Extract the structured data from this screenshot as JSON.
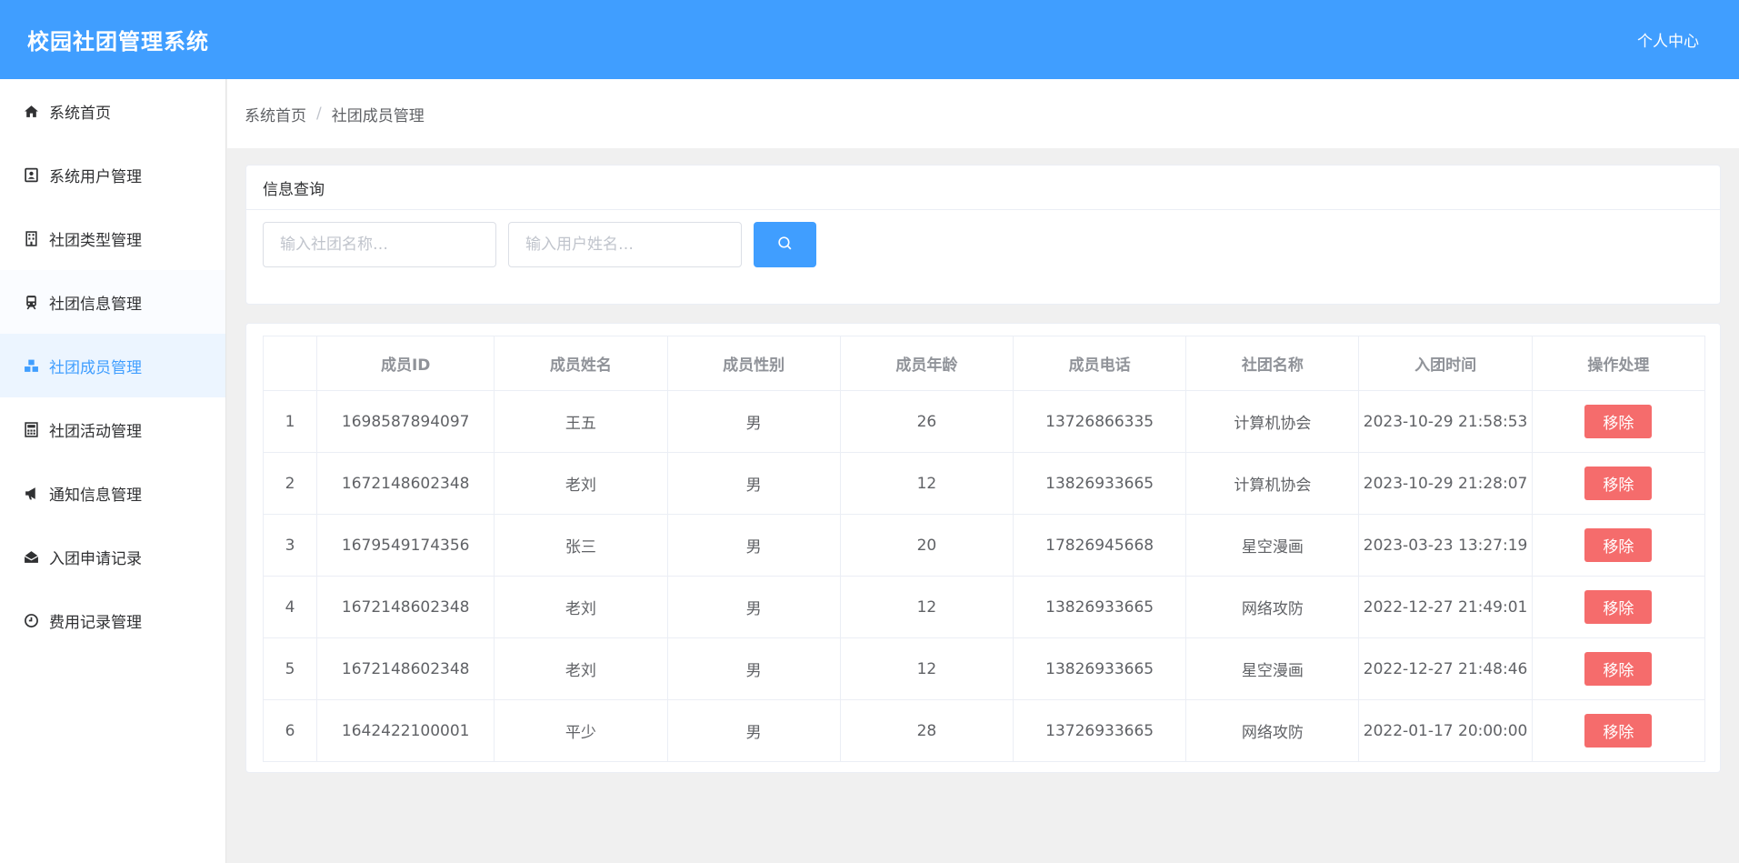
{
  "header": {
    "title": "校园社团管理系统",
    "user_center": "个人中心"
  },
  "colors": {
    "primary": "#409eff",
    "danger": "#f56c6c"
  },
  "sidebar": {
    "items": [
      {
        "label": "系统首页",
        "icon": "home-icon"
      },
      {
        "label": "系统用户管理",
        "icon": "user-card-icon"
      },
      {
        "label": "社团类型管理",
        "icon": "building-icon"
      },
      {
        "label": "社团信息管理",
        "icon": "train-icon"
      },
      {
        "label": "社团成员管理",
        "icon": "cubes-icon",
        "active": true
      },
      {
        "label": "社团活动管理",
        "icon": "calculator-icon"
      },
      {
        "label": "通知信息管理",
        "icon": "bullhorn-icon"
      },
      {
        "label": "入团申请记录",
        "icon": "envelope-open-icon"
      },
      {
        "label": "费用记录管理",
        "icon": "clock-icon"
      }
    ]
  },
  "breadcrumb": {
    "home": "系统首页",
    "separator": "/",
    "current": "社团成员管理"
  },
  "query": {
    "title": "信息查询",
    "club_input": {
      "placeholder": "输入社团名称…",
      "value": ""
    },
    "user_input": {
      "placeholder": "输入用户姓名…",
      "value": ""
    },
    "search_icon": "search-icon"
  },
  "table": {
    "headers": [
      "",
      "成员ID",
      "成员姓名",
      "成员性别",
      "成员年龄",
      "成员电话",
      "社团名称",
      "入团时间",
      "操作处理"
    ],
    "action_label": "移除",
    "rows": [
      {
        "index": "1",
        "id": "1698587894097",
        "name": "王五",
        "gender": "男",
        "age": "26",
        "phone": "13726866335",
        "club": "计算机协会",
        "join_time": "2023-10-29 21:58:53"
      },
      {
        "index": "2",
        "id": "1672148602348",
        "name": "老刘",
        "gender": "男",
        "age": "12",
        "phone": "13826933665",
        "club": "计算机协会",
        "join_time": "2023-10-29 21:28:07"
      },
      {
        "index": "3",
        "id": "1679549174356",
        "name": "张三",
        "gender": "男",
        "age": "20",
        "phone": "17826945668",
        "club": "星空漫画",
        "join_time": "2023-03-23 13:27:19"
      },
      {
        "index": "4",
        "id": "1672148602348",
        "name": "老刘",
        "gender": "男",
        "age": "12",
        "phone": "13826933665",
        "club": "网络攻防",
        "join_time": "2022-12-27 21:49:01"
      },
      {
        "index": "5",
        "id": "1672148602348",
        "name": "老刘",
        "gender": "男",
        "age": "12",
        "phone": "13826933665",
        "club": "星空漫画",
        "join_time": "2022-12-27 21:48:46"
      },
      {
        "index": "6",
        "id": "1642422100001",
        "name": "平少",
        "gender": "男",
        "age": "28",
        "phone": "13726933665",
        "club": "网络攻防",
        "join_time": "2022-01-17 20:00:00"
      }
    ]
  }
}
